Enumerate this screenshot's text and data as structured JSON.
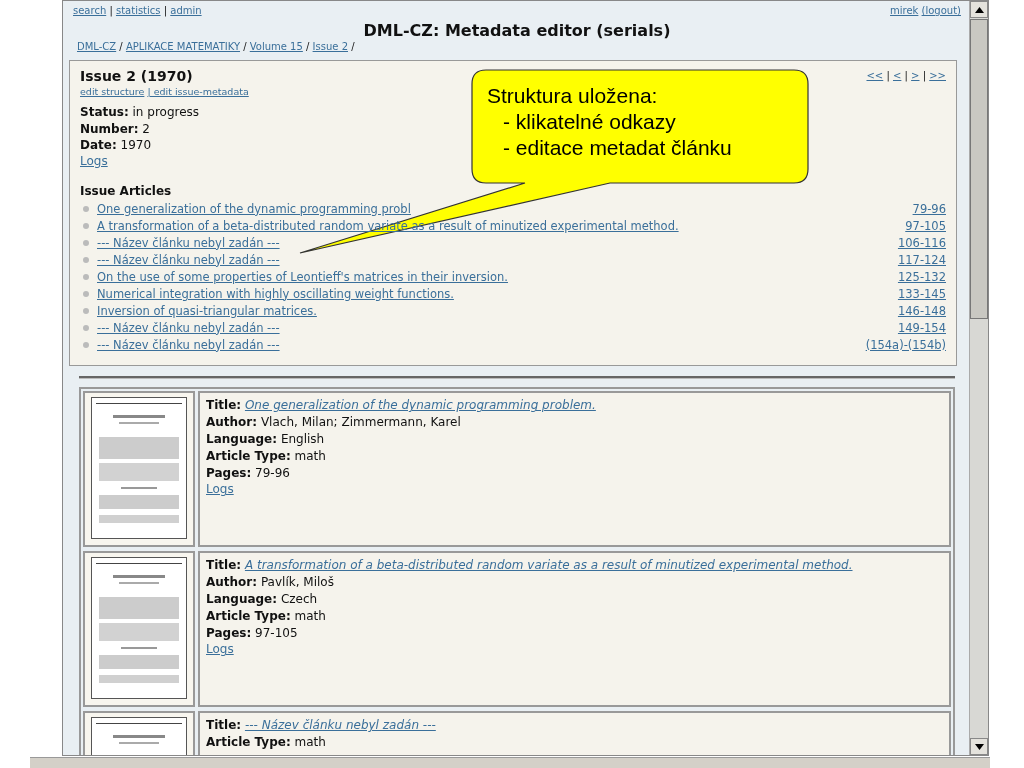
{
  "top_links": [
    {
      "label": "search",
      "sep": "|"
    },
    {
      "label": "statistics",
      "sep": "|"
    },
    {
      "label": "admin"
    }
  ],
  "user": {
    "name": "mirek",
    "logout": "(logout)"
  },
  "title": "DML-CZ: Metadata editor (serials)",
  "breadcrumb": [
    {
      "label": "DML-CZ",
      "sep": "/"
    },
    {
      "label": "APLIKACE MATEMATIKY",
      "sep": "/"
    },
    {
      "label": "Volume 15",
      "sep": "/"
    },
    {
      "label": "Issue 2",
      "sep": "/"
    }
  ],
  "issue": {
    "heading": "Issue 2 (1970)",
    "actions": [
      "edit structure",
      "| edit issue-metadata"
    ],
    "pager": [
      {
        "label": "<<",
        "sep": "|"
      },
      {
        "label": "<",
        "sep": "|"
      },
      {
        "label": ">",
        "sep": "|"
      },
      {
        "label": ">>"
      }
    ],
    "fields": [
      {
        "label": "Status:",
        "value": "in progress"
      },
      {
        "label": "Number:",
        "value": "2"
      },
      {
        "label": "Date:",
        "value": "1970"
      }
    ],
    "logs": "Logs"
  },
  "articles_heading": "Issue Articles",
  "articles": [
    {
      "title": "One generalization of the dynamic programming probl",
      "pages": "79-96"
    },
    {
      "title": "A transformation of a beta-distributed random variate as a result of minutized experimental method.",
      "pages": "97-105"
    },
    {
      "title": "--- Název článku nebyl zadán ---",
      "pages": "106-116"
    },
    {
      "title": "--- Název článku nebyl zadán ---",
      "pages": "117-124"
    },
    {
      "title": "On the use of some properties of Leontieff's matrices in their inversion.",
      "pages": "125-132"
    },
    {
      "title": "Numerical integration with highly oscillating weight functions.",
      "pages": "133-145"
    },
    {
      "title": "Inversion of quasi-triangular matrices.",
      "pages": "146-148"
    },
    {
      "title": "--- Název článku nebyl zadán ---",
      "pages": "149-154"
    },
    {
      "title": "--- Název článku nebyl zadán ---",
      "pages": "(154a)-(154b)"
    }
  ],
  "callout": {
    "title": "Struktura uložena:",
    "lines": [
      "- klikatelné odkazy",
      "- editace metadat článku"
    ]
  },
  "records": [
    {
      "fields": [
        {
          "kind": "link",
          "label": "Title:",
          "value": "One generalization of the dynamic programming problem."
        },
        {
          "kind": "text",
          "label": "Author:",
          "value": "Vlach, Milan; Zimmermann, Karel"
        },
        {
          "kind": "text",
          "label": "Language:",
          "value": "English"
        },
        {
          "kind": "text",
          "label": "Article Type:",
          "value": "math"
        },
        {
          "kind": "text",
          "label": "Pages:",
          "value": "79-96"
        }
      ],
      "logs": "Logs"
    },
    {
      "fields": [
        {
          "kind": "link",
          "label": "Title:",
          "value": "A transformation of a beta-distributed random variate as a result of minutized experimental method."
        },
        {
          "kind": "text",
          "label": "Author:",
          "value": "Pavlík, Miloš"
        },
        {
          "kind": "text",
          "label": "Language:",
          "value": "Czech"
        },
        {
          "kind": "text",
          "label": "Article Type:",
          "value": "math"
        },
        {
          "kind": "text",
          "label": "Pages:",
          "value": "97-105"
        }
      ],
      "logs": "Logs"
    },
    {
      "fields": [
        {
          "kind": "link",
          "label": "Title:",
          "value": "--- Název článku nebyl zadán ---"
        },
        {
          "kind": "text",
          "label": "Article Type:",
          "value": "math"
        }
      ]
    }
  ]
}
